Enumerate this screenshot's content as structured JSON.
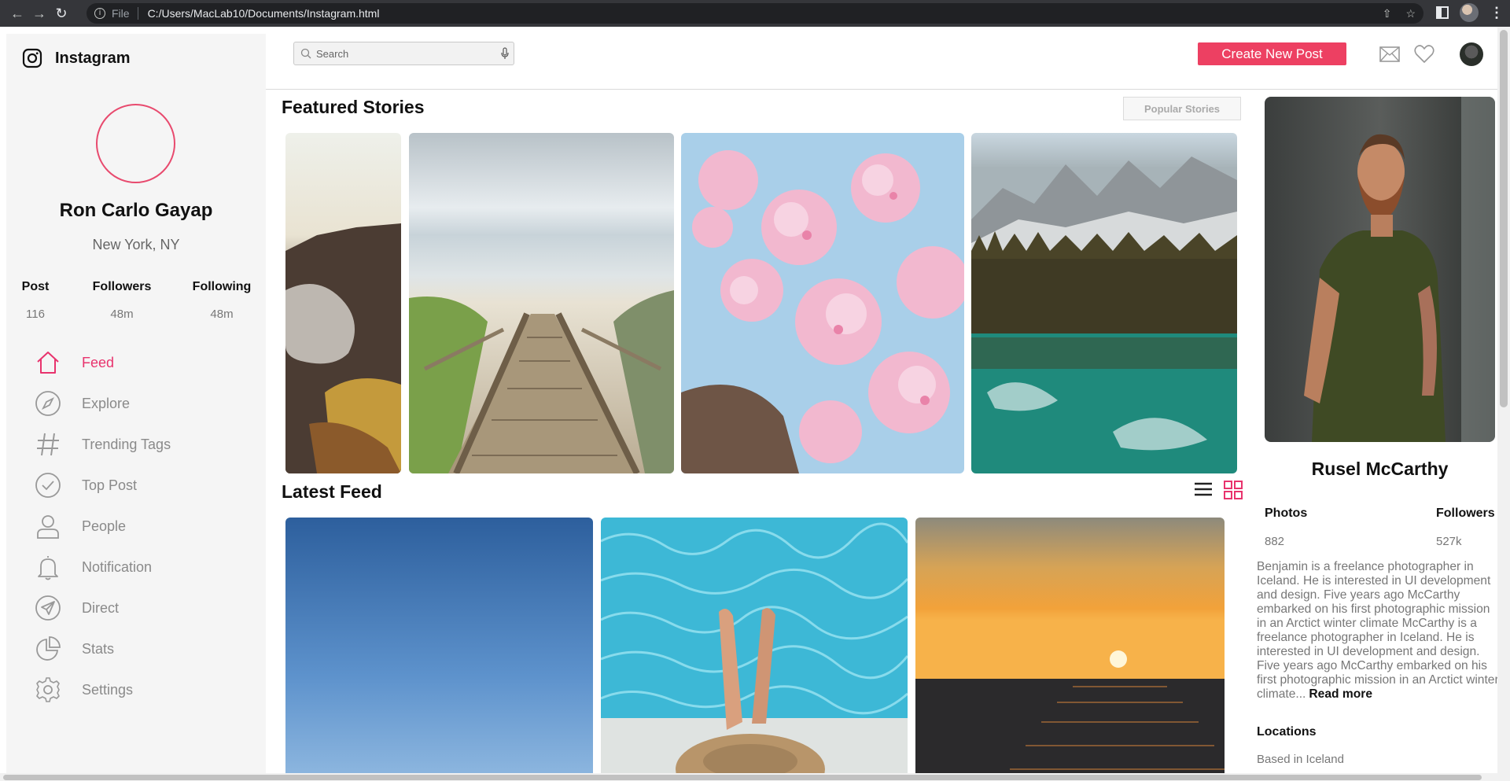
{
  "browser": {
    "scheme": "File",
    "url": "C:/Users/MacLab10/Documents/Instagram.html",
    "info_glyph": "i"
  },
  "brand": {
    "name": "Instagram"
  },
  "user": {
    "name": "Ron Carlo Gayap",
    "location": "New York, NY",
    "stats": [
      {
        "label": "Post",
        "value": "116"
      },
      {
        "label": "Followers",
        "value": "48m"
      },
      {
        "label": "Following",
        "value": "48m"
      }
    ]
  },
  "menu": [
    {
      "label": "Feed",
      "icon": "home-icon",
      "active": true
    },
    {
      "label": "Explore",
      "icon": "compass-icon"
    },
    {
      "label": "Trending Tags",
      "icon": "hashtag-icon"
    },
    {
      "label": "Top Post",
      "icon": "check-circle-icon"
    },
    {
      "label": "People",
      "icon": "person-icon"
    },
    {
      "label": "Notification",
      "icon": "bell-icon"
    },
    {
      "label": "Direct",
      "icon": "send-icon"
    },
    {
      "label": "Stats",
      "icon": "pie-chart-icon"
    },
    {
      "label": "Settings",
      "icon": "gear-icon"
    }
  ],
  "topbar": {
    "search_placeholder": "Search",
    "create_button": "Create New Post"
  },
  "featured": {
    "title": "Featured Stories",
    "popular_button": "Popular Stories"
  },
  "feed": {
    "title": "Latest Feed"
  },
  "profile": {
    "name": "Rusel McCarthy",
    "photos_label": "Photos",
    "photos_value": "882",
    "followers_label": "Followers",
    "followers_value": "527k",
    "bio": "Benjamin is a freelance photographer in Iceland. He is interested in UI development and design. Five years ago McCarthy embarked on his first photographic mission in an Arctict winter climate McCarthy is a freelance photographer in Iceland. He is interested in UI development and design. Five years ago McCarthy embarked on his first photographic mission in an Arctict winter climate...",
    "read_more": "Read more",
    "locations_label": "Locations",
    "location_value": "Based in Iceland"
  },
  "colors": {
    "accent": "#e8336d",
    "button": "#ed4062",
    "sidebar_bg": "#f5f5f5"
  }
}
